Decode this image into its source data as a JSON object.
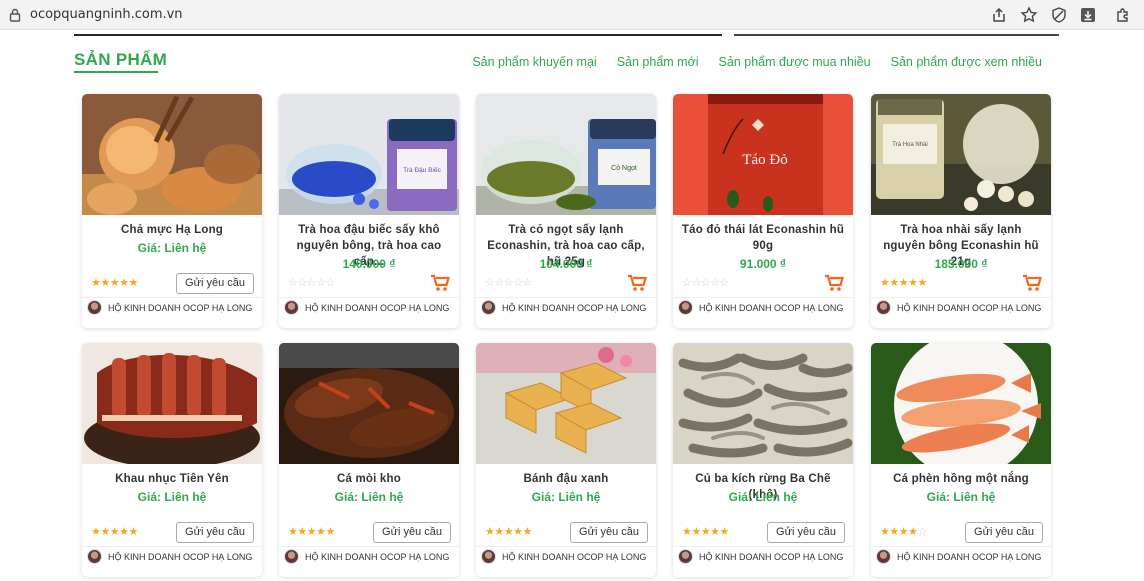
{
  "browser": {
    "url": "ocopquangninh.com.vn"
  },
  "section": {
    "title": "SẢN PHẨM",
    "tabs": [
      "Sản phẩm khuyến mại",
      "Sản phẩm mới",
      "Sản phẩm được mua nhiều",
      "Sản phẩm được xem nhiều"
    ]
  },
  "products": [
    {
      "name": "Chả mực Hạ Long",
      "price": "Giá: Liên hệ",
      "rating": 5,
      "action": "Gửi yêu cầu",
      "shop": "HỘ KINH DOANH OCOP HẠ LONG"
    },
    {
      "name": "Trà hoa đậu biếc sấy khô nguyên bông, trà hoa cao cấp...",
      "price": "140.000 ₫",
      "rating": 0,
      "action": "cart",
      "shop": "HỘ KINH DOANH OCOP HẠ LONG"
    },
    {
      "name": "Trà cỏ ngọt sấy lạnh Econashin, trà hoa cao cấp, hũ 25g",
      "price": "104.000 ₫",
      "rating": 0,
      "action": "cart",
      "shop": "HỘ KINH DOANH OCOP HẠ LONG"
    },
    {
      "name": "Táo đỏ thái lát Econashin hũ 90g",
      "price": "91.000 ₫",
      "rating": 0,
      "action": "cart",
      "shop": "HỘ KINH DOANH OCOP HẠ LONG"
    },
    {
      "name": "Trà hoa nhài sấy lạnh nguyên bông Econashin hũ 21g",
      "price": "185.000 ₫",
      "rating": 5,
      "action": "cart",
      "shop": "HỘ KINH DOANH OCOP HẠ LONG"
    },
    {
      "name": "Khau nhục Tiên Yên",
      "price": "Giá: Liên hệ",
      "rating": 5,
      "action": "Gửi yêu cầu",
      "shop": "HỘ KINH DOANH OCOP HẠ LONG"
    },
    {
      "name": "Cá mòi kho",
      "price": "Giá: Liên hệ",
      "rating": 5,
      "action": "Gửi yêu cầu",
      "shop": "HỘ KINH DOANH OCOP HẠ LONG"
    },
    {
      "name": "Bánh đậu xanh",
      "price": "Giá: Liên hệ",
      "rating": 5,
      "action": "Gửi yêu cầu",
      "shop": "HỘ KINH DOANH OCOP HẠ LONG"
    },
    {
      "name": "Củ ba kích rừng Ba Chẽ (khô)",
      "price": "Giá: Liên hệ",
      "rating": 5,
      "action": "Gửi yêu cầu",
      "shop": "HỘ KINH DOANH OCOP HẠ LONG"
    },
    {
      "name": "Cá phèn hồng một nắng",
      "price": "Giá: Liên hệ",
      "rating": 4,
      "action": "Gửi yêu cầu",
      "shop": "HỘ KINH DOANH OCOP HẠ LONG"
    }
  ],
  "jar_labels": {
    "p2": "Trà Đậu Biếc",
    "p3": "Cỏ Ngọt",
    "p4": "Táo Đỏ",
    "p5": "Trà Hoa Nhài"
  },
  "colors": {
    "accent": "#2fa84f",
    "star": "#f5a623",
    "cart": "#f26522"
  }
}
